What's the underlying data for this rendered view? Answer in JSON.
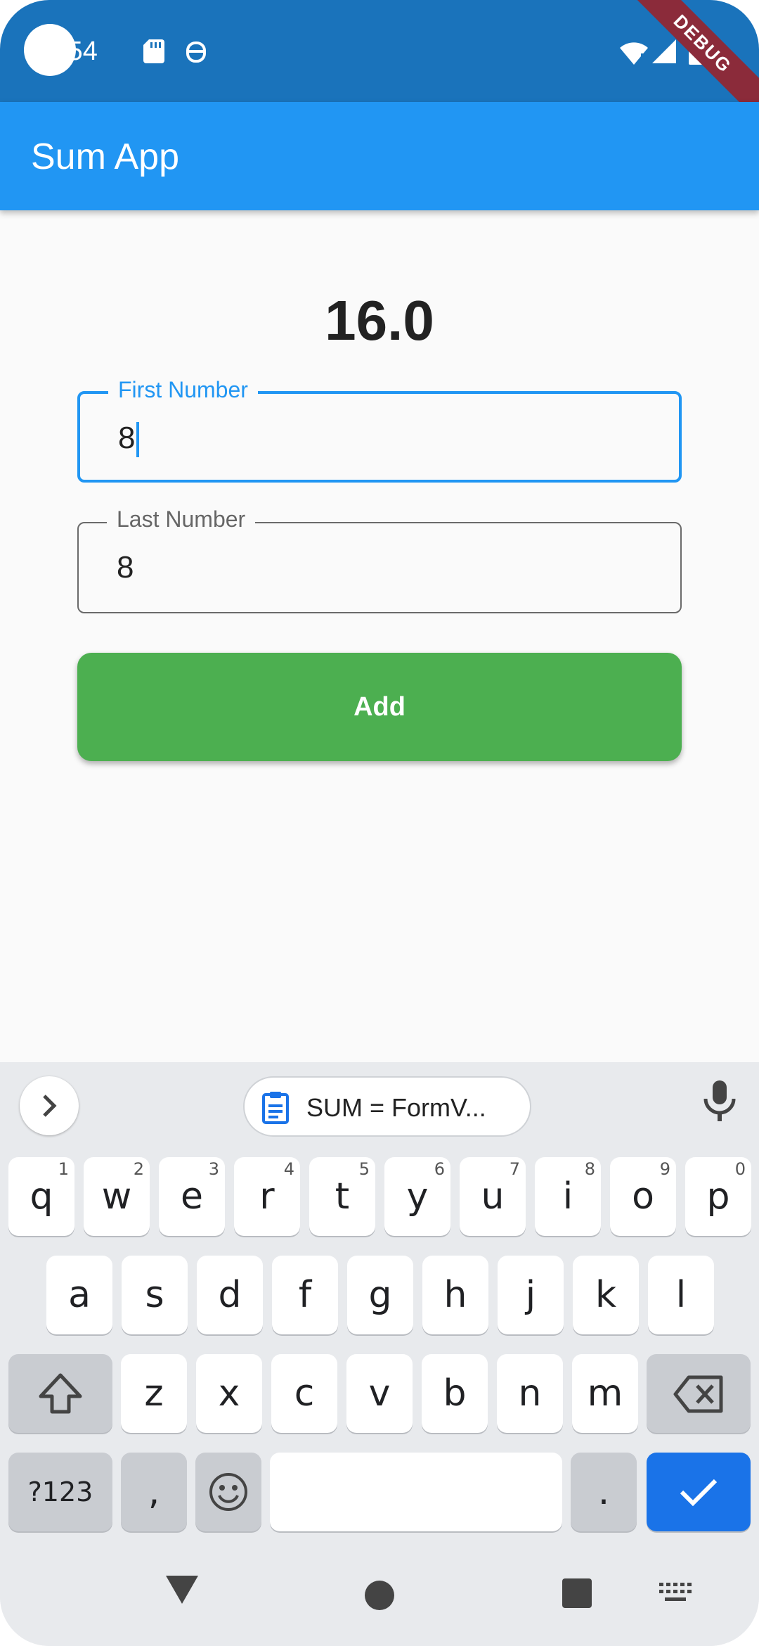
{
  "status_bar": {
    "time": ":54",
    "debug_banner": "DEBUG"
  },
  "app_bar": {
    "title": "Sum App"
  },
  "result": {
    "value": "16.0"
  },
  "fields": {
    "first": {
      "label": "First Number",
      "value": "8"
    },
    "last": {
      "label": "Last Number",
      "value": "8"
    }
  },
  "add_button": {
    "label": "Add",
    "color": "#4caf50"
  },
  "keyboard": {
    "clipboard_chip": "SUM = FormV...",
    "row1": [
      {
        "key": "q",
        "hint": "1"
      },
      {
        "key": "w",
        "hint": "2"
      },
      {
        "key": "e",
        "hint": "3"
      },
      {
        "key": "r",
        "hint": "4"
      },
      {
        "key": "t",
        "hint": "5"
      },
      {
        "key": "y",
        "hint": "6"
      },
      {
        "key": "u",
        "hint": "7"
      },
      {
        "key": "i",
        "hint": "8"
      },
      {
        "key": "o",
        "hint": "9"
      },
      {
        "key": "p",
        "hint": "0"
      }
    ],
    "row2": [
      "a",
      "s",
      "d",
      "f",
      "g",
      "h",
      "j",
      "k",
      "l"
    ],
    "row3": [
      "z",
      "x",
      "c",
      "v",
      "b",
      "n",
      "m"
    ],
    "symbols_key": "?123",
    "comma_key": ",",
    "period_key": "."
  },
  "colors": {
    "status_bar": "#1a73bb",
    "app_bar": "#2196f3",
    "enter_key": "#1a73e8"
  }
}
